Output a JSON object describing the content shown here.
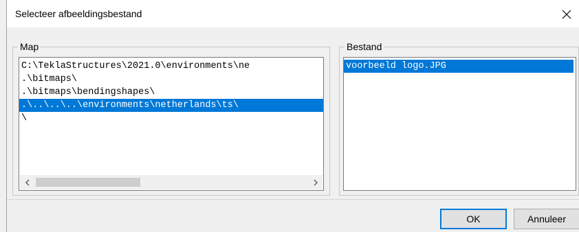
{
  "window": {
    "title": "Selecteer afbeeldingsbestand",
    "close_icon": "close-icon"
  },
  "map_group": {
    "label": "Map",
    "items": [
      "C:\\TeklaStructures\\2021.0\\environments\\ne",
      ".\\bitmaps\\",
      ".\\bitmaps\\bendingshapes\\",
      ".\\..\\..\\..\\environments\\netherlands\\ts\\",
      "\\"
    ],
    "selected_index": 3,
    "scroll_position": 0.0
  },
  "file_group": {
    "label": "Bestand",
    "items": [
      "voorbeeld logo.JPG"
    ],
    "selected_index": 0
  },
  "buttons": {
    "ok": "OK",
    "cancel": "Annuleer"
  },
  "colors": {
    "selection": "#0078d7",
    "background": "#f0f0f0"
  }
}
